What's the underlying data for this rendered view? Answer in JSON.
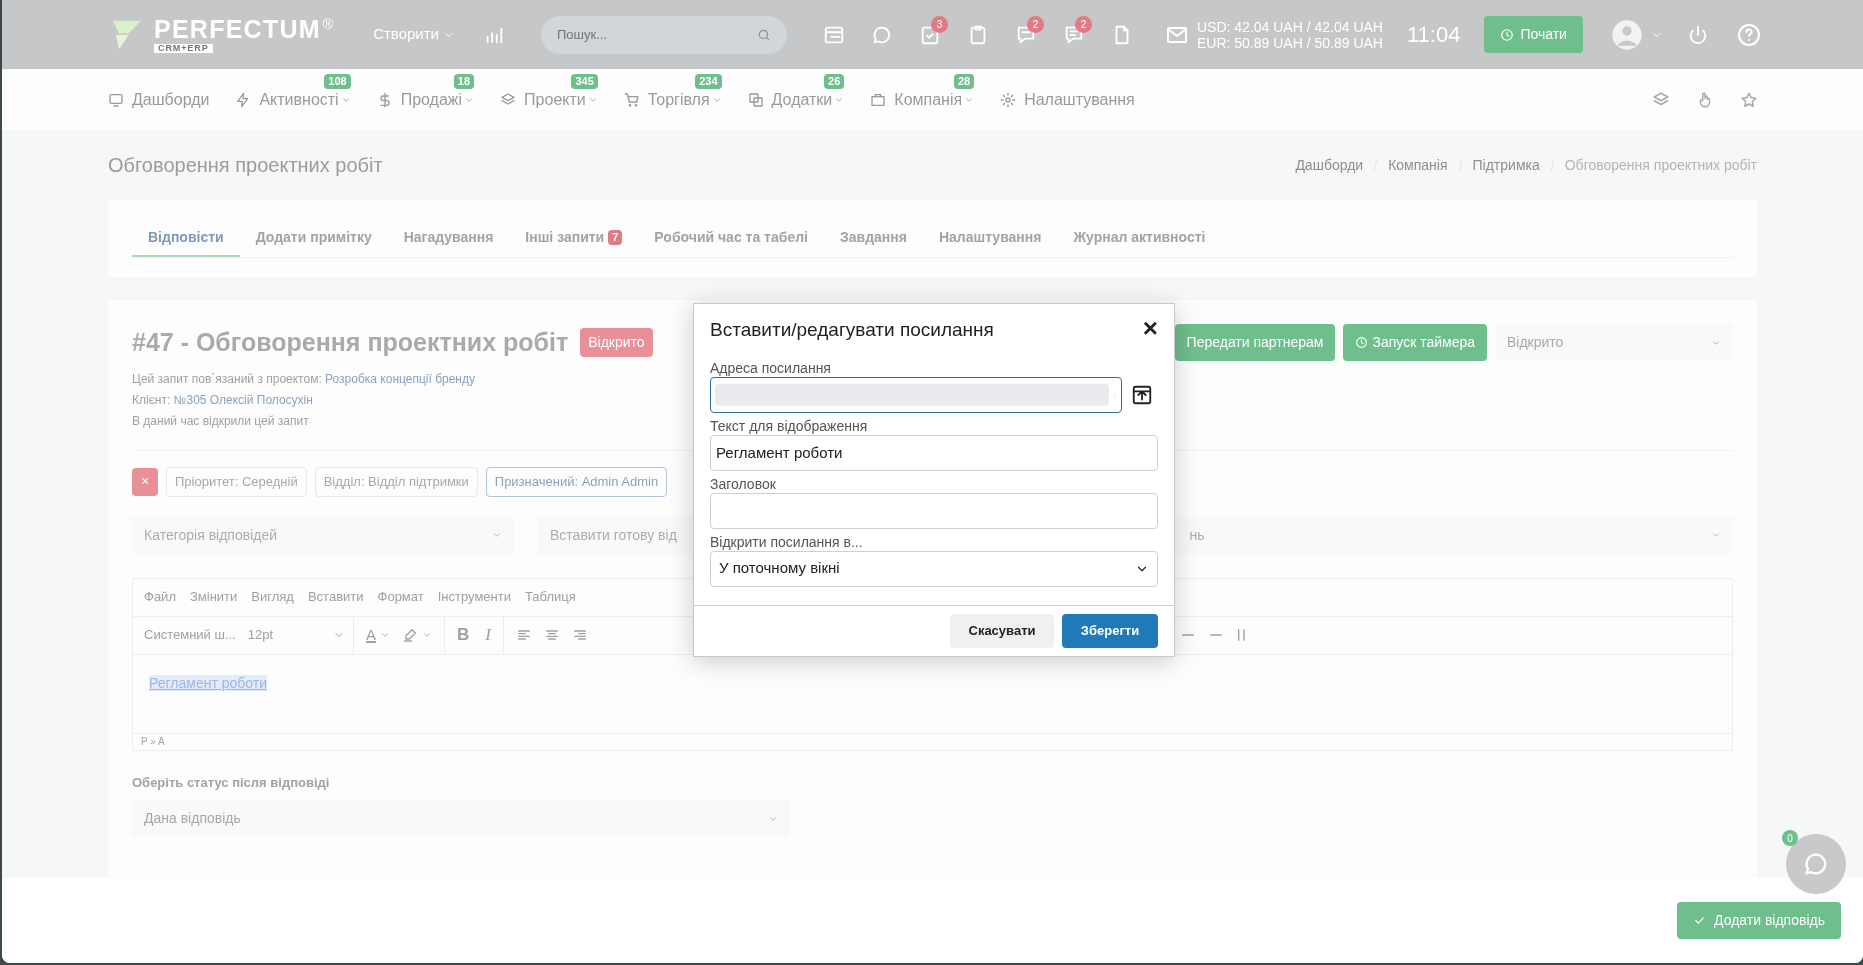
{
  "topbar": {
    "logo": "PERFECTUM",
    "logo_mark": "®",
    "logo_sub": "CRM+ERP",
    "create_menu": "Створити",
    "search": {
      "placeholder": "Пошук..."
    },
    "notification_badges": [
      {
        "count": "3"
      },
      {
        "count": "2"
      },
      {
        "count": "2"
      }
    ],
    "currency": [
      "USD: 42.04 UAH / 42.04 UAH",
      "EUR: 50.89 UAH / 50.89 UAH"
    ],
    "time": "11:04",
    "start_button": "Почати"
  },
  "nav": [
    {
      "label": "Дашборди"
    },
    {
      "label": "Активності",
      "count": "108"
    },
    {
      "label": "Продажі",
      "count": "18"
    },
    {
      "label": "Проекти",
      "count": "345"
    },
    {
      "label": "Торгівля",
      "count": "234"
    },
    {
      "label": "Додатки",
      "count": "26"
    },
    {
      "label": "Компанія",
      "count": "28"
    },
    {
      "label": "Налаштування"
    }
  ],
  "page_title": "Обговорення проектних робіт",
  "breadcrumb": [
    {
      "label": "Дашборди",
      "current": false
    },
    {
      "label": "Компанія",
      "current": false
    },
    {
      "label": "Підтримка",
      "current": false
    },
    {
      "label": "Обговорення проектних робіт",
      "current": true
    }
  ],
  "tabs": [
    {
      "label": "Відповісти",
      "selected": true
    },
    {
      "label": "Додати примітку",
      "selected": false
    },
    {
      "label": "Нагадування",
      "selected": false
    },
    {
      "label": "Інші запити",
      "selected": false,
      "badge": "7"
    },
    {
      "label": "Робочий час та табелі",
      "selected": false
    },
    {
      "label": "Завдання",
      "selected": false
    },
    {
      "label": "Налаштування",
      "selected": false
    },
    {
      "label": "Журнал активності",
      "selected": false
    }
  ],
  "ticket": {
    "title": "#47 - Обговорення проектних робіт",
    "status": "Відкрито",
    "info": [
      {
        "label": "Цей запит пов`язаний з проектом: ",
        "link": "Розробка концепції бренду"
      },
      {
        "label": "Клієнт: ",
        "link": "№305 Олексій Полосухін"
      },
      {
        "label": "В даний час відкрили цей запит"
      }
    ],
    "remove_chip": "×",
    "chips": [
      {
        "label": "Пріоритет: Середній",
        "highlighted": false
      },
      {
        "label": "Відділ: Відділ підтримки",
        "highlighted": false
      },
      {
        "label": "Призначений: Admin Admin",
        "highlighted": true
      }
    ],
    "actions": [
      "Передати партнерам",
      "Запуск таймера"
    ],
    "status_select": "Відкрито",
    "selects": [
      "Категорія відповідей",
      "Вставити готову від",
      "нь"
    ]
  },
  "editor": {
    "menu": [
      "Файл",
      "Змінити",
      "Вигляд",
      "Вставити",
      "Формат",
      "Інструменти",
      "Таблиця"
    ],
    "font": "Системний ш...",
    "size": "12pt",
    "color_glyph": "A",
    "format_buttons": [
      "B",
      "I"
    ],
    "content_link": "Регламент роботи",
    "path": "P » A"
  },
  "status_after": {
    "label": "Оберіть статус після відповіді",
    "value": "Дана відповідь"
  },
  "submit_button": "Додати відповідь",
  "chat": {
    "badge": "0"
  },
  "dialog": {
    "title": "Вставити/редагувати посилання",
    "close": "×",
    "fields": [
      {
        "kind": "url",
        "label": "Адреса посилання"
      },
      {
        "kind": "text",
        "label": "Текст для відображення",
        "value": "Регламент роботи"
      },
      {
        "kind": "text",
        "label": "Заголовок"
      },
      {
        "kind": "select",
        "label": "Відкрити посилання в...",
        "value": "У поточному вікні"
      }
    ],
    "buttons": [
      {
        "label": "Скасувати",
        "primary": false
      },
      {
        "label": "Зберегти",
        "primary": true
      }
    ]
  }
}
